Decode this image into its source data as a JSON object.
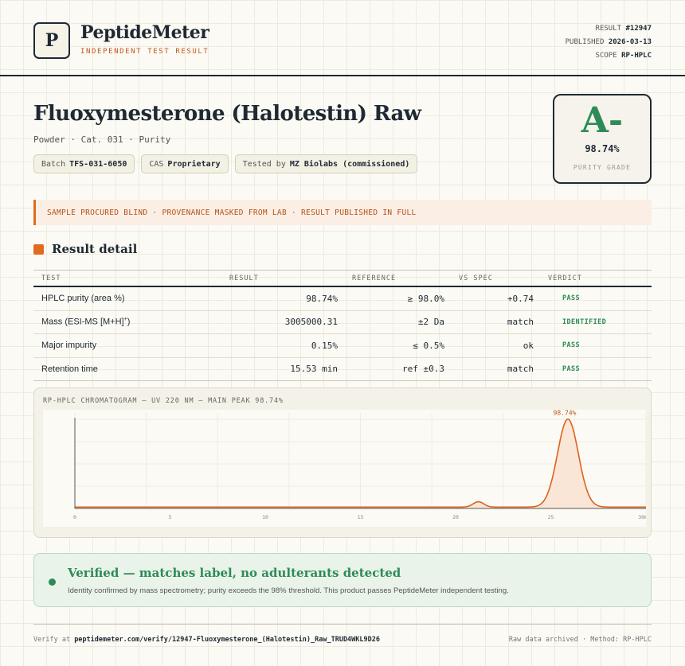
{
  "header": {
    "logo_letter": "P",
    "brand": "PeptideMeter",
    "brand_sub": "INDEPENDENT TEST RESULT",
    "meta": {
      "result_label": "RESULT",
      "result_value": "#12947",
      "published_label": "PUBLISHED",
      "published_value": "2026-03-13",
      "scope_label": "SCOPE",
      "scope_value": "RP-HPLC"
    }
  },
  "product": {
    "title": "Fluoxymesterone (Halotestin) Raw",
    "subtitle": "Powder · Cat. 031 · Purity",
    "chips": [
      {
        "label": "Batch",
        "value": "TFS-031-6050"
      },
      {
        "label": "CAS",
        "value": "Proprietary"
      },
      {
        "label": "Tested by",
        "value": "MZ Biolabs (commissioned)"
      }
    ]
  },
  "grade": {
    "letter": "A-",
    "value": "98.74%",
    "label": "PURITY GRADE"
  },
  "banner": "SAMPLE PROCURED BLIND · PROVENANCE MASKED FROM LAB · RESULT PUBLISHED IN FULL",
  "section_title": "Result detail",
  "table": {
    "headers": [
      "TEST",
      "RESULT",
      "REFERENCE",
      "VS SPEC",
      "VERDICT"
    ],
    "rows": [
      {
        "test": "HPLC purity (area %)",
        "result": "98.74%",
        "reference": "≥ 98.0%",
        "vs_spec": "+0.74",
        "verdict": "PASS"
      },
      {
        "test": "Mass (ESI-MS [M+H]",
        "test_sup": "+",
        "test_end": ")",
        "result": "3005000.31",
        "reference": "±2 Da",
        "vs_spec": "match",
        "verdict": "IDENTIFIED"
      },
      {
        "test": "Major impurity",
        "result": "0.15%",
        "reference": "≤ 0.5%",
        "vs_spec": "ok",
        "verdict": "PASS"
      },
      {
        "test": "Retention time",
        "result": "15.53 min",
        "reference": "ref ±0.3",
        "vs_spec": "match",
        "verdict": "PASS"
      }
    ]
  },
  "chart_data": {
    "type": "line",
    "title": "RP-HPLC CHROMATOGRAM — UV 220 NM — MAIN PEAK 98.74%",
    "xlabel": "",
    "ylabel": "",
    "x_ticks": [
      "0",
      "5",
      "10",
      "15",
      "20",
      "25",
      "30"
    ],
    "x_tick_unit": "min",
    "xlim": [
      0,
      30
    ],
    "ylim": [
      0,
      100
    ],
    "baseline": 1.5,
    "peaks": [
      {
        "x": 21.2,
        "height": 6,
        "width": 0.28
      },
      {
        "x": 25.9,
        "height": 98.74,
        "width": 0.55,
        "label": "98.74%"
      }
    ],
    "series_color": "#d96420",
    "fill_color": "#fae6d6",
    "grid": true
  },
  "verified": {
    "title": "Verified — matches label, no adulterants detected",
    "text": "Identity confirmed by mass spectrometry; purity exceeds the 98% threshold. This product passes PeptideMeter independent testing."
  },
  "footer": {
    "verify_prefix": "Verify at",
    "verify_url": "peptidemeter.com/verify/12947-Fluoxymesterone_(Halotestin)_Raw_TRUD4WKL9D26",
    "right": "Raw data archived · Method: RP-HPLC"
  }
}
